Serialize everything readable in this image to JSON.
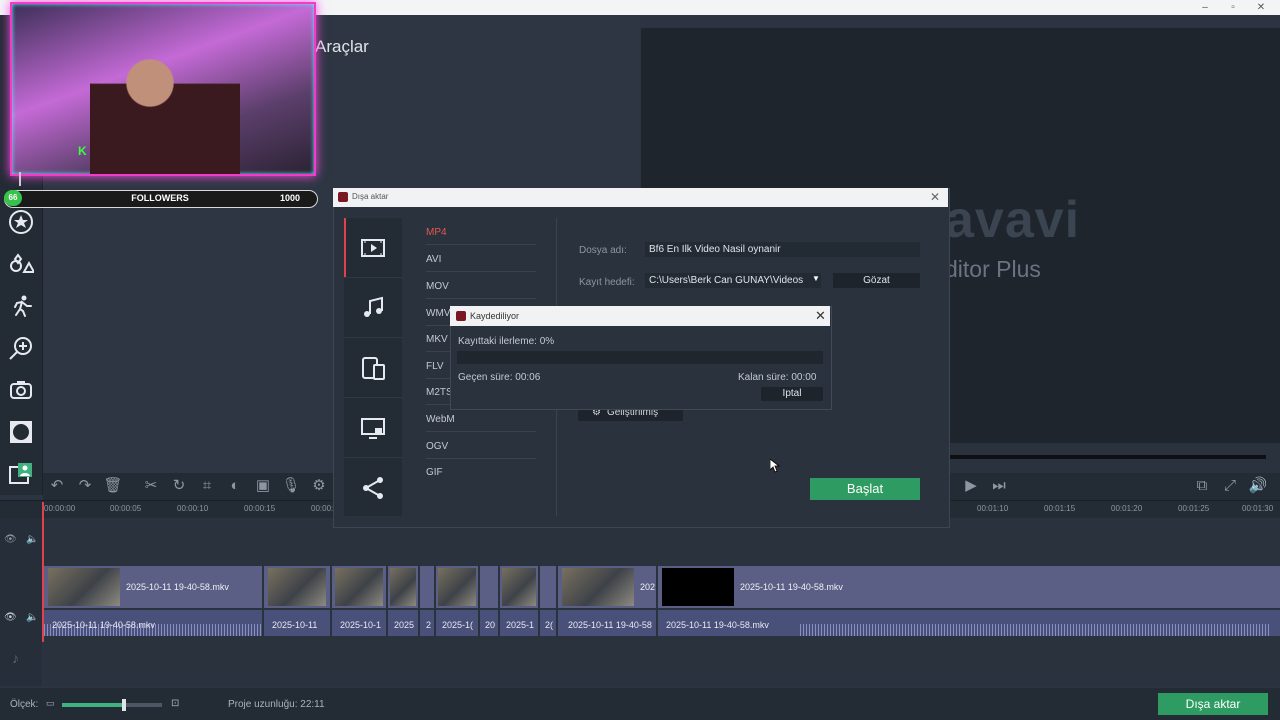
{
  "tools_title": "Araçlar",
  "preview": {
    "brand_top": "avavi",
    "brand_sub": "ditor Plus"
  },
  "webcam": {
    "followers_label": "FOLLOWERS",
    "followers_current": "66",
    "followers_goal": "1000",
    "badge_letter": "K"
  },
  "export_dialog": {
    "title": "Dışa aktar",
    "formats": [
      "MP4",
      "AVI",
      "MOV",
      "WMV",
      "MKV",
      "FLV",
      "M2TS",
      "WebM",
      "OGV",
      "GIF"
    ],
    "selected_format": "MP4",
    "file_name_label": "Dosya adı:",
    "file_name_value": "Bf6 En Ilk Video Nasil oynanir",
    "save_target_label": "Kayıt hedefi:",
    "save_target_value": "C:\\Users\\Berk Can GUNAY\\Videos",
    "browse_label": "Gözat",
    "advanced_label": "Geliştirilmiş",
    "start_label": "Başlat"
  },
  "save_dialog": {
    "title": "Kaydediliyor",
    "progress_label": "Kayıttaki ilerleme:",
    "progress_value": "0%",
    "progress_fraction": 0,
    "elapsed_label": "Geçen süre:",
    "elapsed_value": "00:06",
    "remaining_label": "Kalan süre:",
    "remaining_value": "00:00",
    "cancel_label": "Iptal"
  },
  "timeline": {
    "ticks_left": [
      "00:00:00",
      "00:00:05",
      "00:00:10",
      "00:00:15",
      "00:00:2"
    ],
    "ticks_right": [
      "00:01:10",
      "00:01:15",
      "00:01:20",
      "00:01:25",
      "00:01:30"
    ],
    "clip_name": "2025-10-11 19-40-58.mkv",
    "short_labels": [
      "2025-10-11",
      "2025-10-1",
      "2025",
      "2",
      "2025-1(",
      "20",
      "2025-1",
      "2(",
      "2025-10-11 19-40-58",
      "202"
    ]
  },
  "footer": {
    "scale_label": "Ölçek:",
    "project_length_label": "Proje uzunluğu:",
    "project_length_value": "22:11",
    "export_button": "Dışa aktar",
    "scale_level": 0.62
  },
  "icons": [
    "star-icon",
    "shapes-icon",
    "motion-icon",
    "zoom-icon",
    "camera-icon",
    "vignette-icon",
    "webcam-icon"
  ]
}
